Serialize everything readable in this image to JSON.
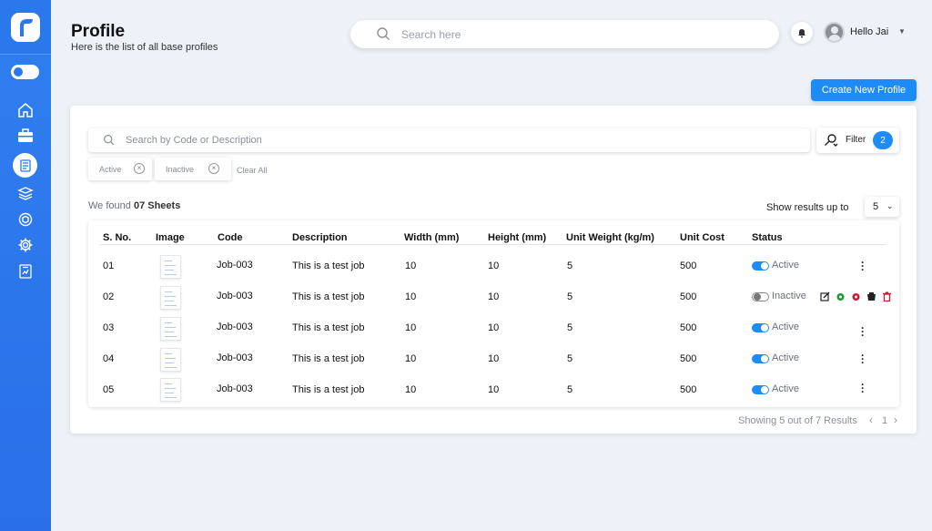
{
  "header": {
    "title": "Profile",
    "subtitle": "Here is the list of all base profiles",
    "search_placeholder": "Search here",
    "greeting": "Hello Jai"
  },
  "actions": {
    "create_label": "Create New Profile"
  },
  "filters": {
    "search_placeholder": "Search by Code or Description",
    "filter_label": "Filter",
    "filter_count": "2",
    "chips": [
      "Active",
      "Inactive"
    ],
    "clear_all": "Clear All"
  },
  "summary": {
    "found_prefix": "We found",
    "found_count": "07 Sheets",
    "show_label": "Show results up to",
    "show_value": "5"
  },
  "table": {
    "columns": [
      "S. No.",
      "Image",
      "Code",
      "Description",
      "Width (mm)",
      "Height (mm)",
      "Unit Weight (kg/m)",
      "Unit Cost",
      "Status"
    ],
    "rows": [
      {
        "sno": "01",
        "code": "Job-003",
        "description": "This is a test job",
        "width": "10",
        "height": "10",
        "weight": "5",
        "cost": "500",
        "status": "Active"
      },
      {
        "sno": "02",
        "code": "Job-003",
        "description": "This is a test job",
        "width": "10",
        "height": "10",
        "weight": "5",
        "cost": "500",
        "status": "Inactive"
      },
      {
        "sno": "03",
        "code": "Job-003",
        "description": "This is a test job",
        "width": "10",
        "height": "10",
        "weight": "5",
        "cost": "500",
        "status": "Active"
      },
      {
        "sno": "04",
        "code": "Job-003",
        "description": "This is a test job",
        "width": "10",
        "height": "10",
        "weight": "5",
        "cost": "500",
        "status": "Active"
      },
      {
        "sno": "05",
        "code": "Job-003",
        "description": "This is a test job",
        "width": "10",
        "height": "10",
        "weight": "5",
        "cost": "500",
        "status": "Active"
      }
    ]
  },
  "pagination": {
    "results_text": "Showing 5 out of 7 Results",
    "page": "1"
  },
  "colors": {
    "primary": "#1d8cf8",
    "sidebar": "#2a78ec",
    "background": "#eef1f7"
  }
}
